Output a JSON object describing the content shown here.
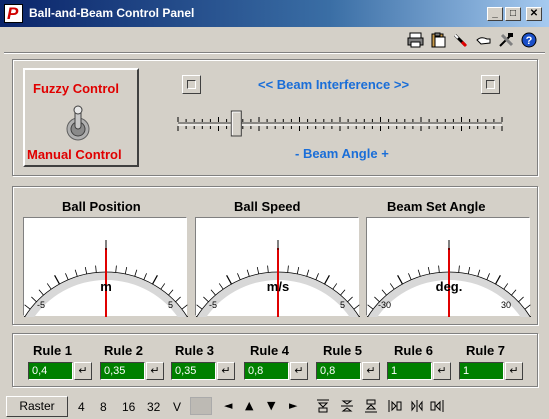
{
  "window": {
    "title": "Ball-and-Beam Control Panel",
    "app_icon_letter": "P",
    "minimize": "_",
    "maximize": "□",
    "close": "✕"
  },
  "toolbar": {
    "icons": [
      "printer-icon",
      "clipboard-icon",
      "pen-icon",
      "hand-icon",
      "tools-icon",
      "help-icon"
    ]
  },
  "mode": {
    "fuzzy_label": "Fuzzy Control",
    "manual_label": "Manual Control"
  },
  "beam": {
    "interference_label": "<< Beam Interference >>",
    "angle_label": "- Beam Angle +",
    "slider_value_fraction": 0.18
  },
  "meters": [
    {
      "title": "Ball Position",
      "unit": "m",
      "min": "-5",
      "max": "5",
      "needle_fraction": 0.5
    },
    {
      "title": "Ball Speed",
      "unit": "m/s",
      "min": "-5",
      "max": "5",
      "needle_fraction": 0.5
    },
    {
      "title": "Beam Set Angle",
      "unit": "deg.",
      "min": "-30",
      "max": "30",
      "needle_fraction": 0.5
    }
  ],
  "rules": [
    {
      "label": "Rule 1",
      "value": "0,4"
    },
    {
      "label": "Rule 2",
      "value": "0,35"
    },
    {
      "label": "Rule 3",
      "value": "0,35"
    },
    {
      "label": "Rule 4",
      "value": "0,8"
    },
    {
      "label": "Rule 5",
      "value": "0,8"
    },
    {
      "label": "Rule 6",
      "value": "1"
    },
    {
      "label": "Rule 7",
      "value": "1"
    }
  ],
  "enter_glyph": "↵",
  "statusbar": {
    "raster_label": "Raster",
    "raster_values": [
      "4",
      "8",
      "16",
      "32"
    ],
    "v_label": "V",
    "arrows": [
      "◄",
      "▲",
      "▼",
      "►"
    ]
  },
  "colors": {
    "title_gradient_start": "#0a246a",
    "label_red": "#e00000",
    "label_blue": "#1a6ed8",
    "rule_field_green": "#008000",
    "needle_red": "#e00000"
  }
}
